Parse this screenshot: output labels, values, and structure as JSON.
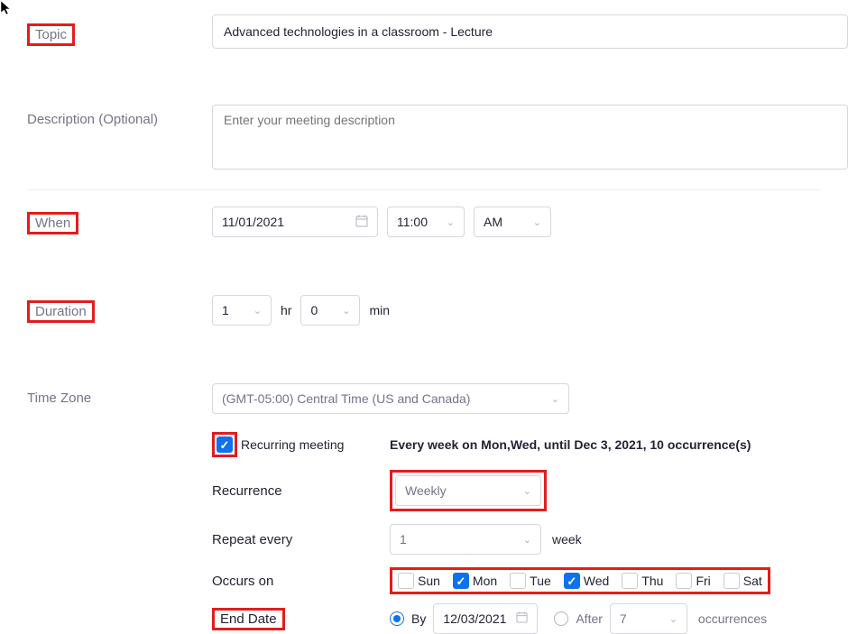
{
  "topic": {
    "label": "Topic",
    "value": "Advanced technologies in a classroom - Lecture"
  },
  "description": {
    "label": "Description (Optional)",
    "placeholder": "Enter your meeting description",
    "value": ""
  },
  "when": {
    "label": "When",
    "date": "11/01/2021",
    "time": "11:00",
    "ampm": "AM"
  },
  "duration": {
    "label": "Duration",
    "hours": "1",
    "hours_unit": "hr",
    "minutes": "0",
    "minutes_unit": "min"
  },
  "timezone": {
    "label": "Time Zone",
    "value": "(GMT-05:00) Central Time (US and Canada)"
  },
  "recurring": {
    "checkbox_label": "Recurring meeting",
    "summary": "Every week on Mon,Wed, until Dec 3, 2021, 10 occurrence(s)",
    "recurrence_label": "Recurrence",
    "recurrence_value": "Weekly",
    "repeat_label": "Repeat every",
    "repeat_value": "1",
    "repeat_unit": "week",
    "occurs_label": "Occurs on",
    "days": [
      {
        "label": "Sun",
        "checked": false
      },
      {
        "label": "Mon",
        "checked": true
      },
      {
        "label": "Tue",
        "checked": false
      },
      {
        "label": "Wed",
        "checked": true
      },
      {
        "label": "Thu",
        "checked": false
      },
      {
        "label": "Fri",
        "checked": false
      },
      {
        "label": "Sat",
        "checked": false
      }
    ],
    "end_label": "End Date",
    "end_by_label": "By",
    "end_by_date": "12/03/2021",
    "end_after_label": "After",
    "end_after_value": "7",
    "end_after_unit": "occurrences"
  }
}
